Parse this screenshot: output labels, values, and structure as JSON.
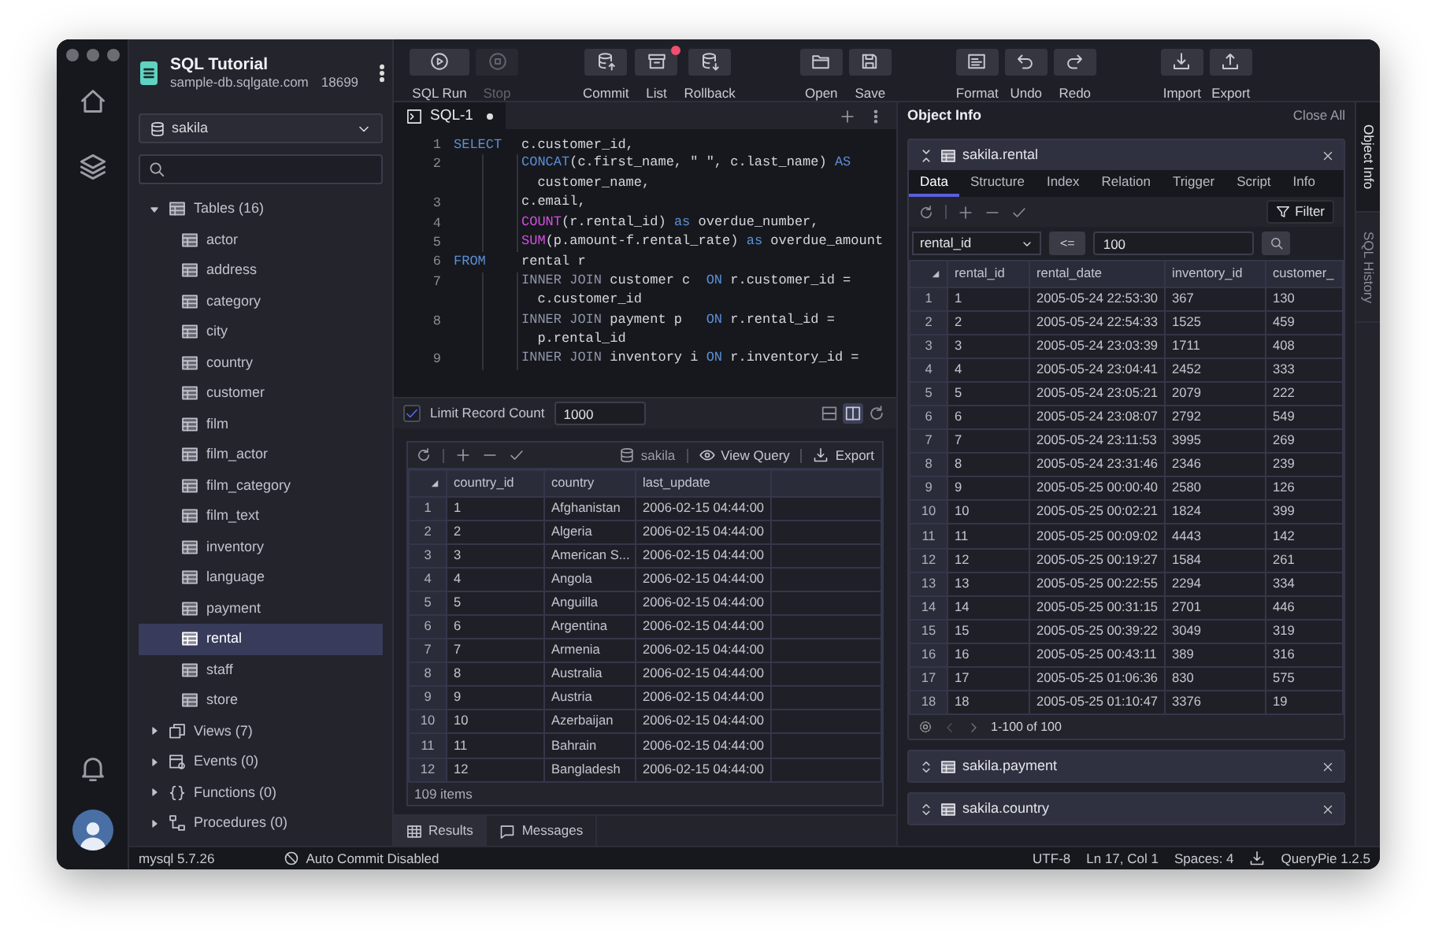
{
  "connection": {
    "title": "SQL Tutorial",
    "host": "sample-db.sqlgate.com",
    "port": "18699"
  },
  "database_select": {
    "value": "sakila"
  },
  "tree": [
    {
      "label": "Tables (16)",
      "kind": "tables",
      "expanded": true,
      "children": [
        {
          "label": "actor",
          "selected": false
        },
        {
          "label": "address",
          "selected": false
        },
        {
          "label": "category",
          "selected": false
        },
        {
          "label": "city",
          "selected": false
        },
        {
          "label": "country",
          "selected": false
        },
        {
          "label": "customer",
          "selected": false
        },
        {
          "label": "film",
          "selected": false
        },
        {
          "label": "film_actor",
          "selected": false
        },
        {
          "label": "film_category",
          "selected": false
        },
        {
          "label": "film_text",
          "selected": false
        },
        {
          "label": "inventory",
          "selected": false
        },
        {
          "label": "language",
          "selected": false
        },
        {
          "label": "payment",
          "selected": false
        },
        {
          "label": "rental",
          "selected": true
        },
        {
          "label": "staff",
          "selected": false
        },
        {
          "label": "store",
          "selected": false
        }
      ]
    },
    {
      "label": "Views (7)",
      "kind": "views",
      "expanded": false
    },
    {
      "label": "Events (0)",
      "kind": "events",
      "expanded": false
    },
    {
      "label": "Functions (0)",
      "kind": "functions",
      "expanded": false
    },
    {
      "label": "Procedures (0)",
      "kind": "procedures",
      "expanded": false
    }
  ],
  "toolbar": [
    [
      {
        "label": "SQL Run",
        "kind": "run",
        "disabled": false,
        "notification": false
      },
      {
        "label": "Stop",
        "kind": "stop",
        "disabled": true,
        "notification": false
      }
    ],
    [
      {
        "label": "Commit",
        "kind": "commit",
        "disabled": false,
        "notification": false
      },
      {
        "label": "List",
        "kind": "list",
        "disabled": false,
        "notification": true
      },
      {
        "label": "Rollback",
        "kind": "rollback",
        "disabled": false,
        "notification": false
      }
    ],
    [
      {
        "label": "Open",
        "kind": "open",
        "disabled": false,
        "notification": false
      },
      {
        "label": "Save",
        "kind": "save",
        "disabled": false,
        "notification": false
      }
    ],
    [
      {
        "label": "Format",
        "kind": "format",
        "disabled": false,
        "notification": false
      },
      {
        "label": "Undo",
        "kind": "undo",
        "disabled": false,
        "notification": false
      },
      {
        "label": "Redo",
        "kind": "redo",
        "disabled": false,
        "notification": false
      }
    ],
    [
      {
        "label": "Import",
        "kind": "import",
        "disabled": false,
        "notification": false
      },
      {
        "label": "Export",
        "kind": "export",
        "disabled": false,
        "notification": false
      }
    ]
  ],
  "editor": {
    "tabs": [
      {
        "label": "SQL-1",
        "selected": true,
        "modified": true
      }
    ],
    "lines": [
      {
        "number": "1",
        "keyword": "SELECT",
        "parts": [
          {
            "text": "c.customer_id,",
            "kind": "plain"
          }
        ]
      },
      {
        "number": "2",
        "parts": [
          {
            "text": "CONCAT",
            "kind": "keyword"
          },
          {
            "text": "(c.first_name, \" \", c.last_name) ",
            "kind": "plain"
          },
          {
            "text": "AS",
            "kind": "keyword"
          }
        ],
        "continuation": [
          {
            "text": "customer_name,",
            "kind": "plain"
          }
        ]
      },
      {
        "number": "3",
        "parts": [
          {
            "text": "c.email,",
            "kind": "plain"
          }
        ]
      },
      {
        "number": "4",
        "parts": [
          {
            "text": "COUNT",
            "kind": "function"
          },
          {
            "text": "(r.rental_id) ",
            "kind": "plain"
          },
          {
            "text": "as",
            "kind": "keyword"
          },
          {
            "text": " overdue_number,",
            "kind": "plain"
          }
        ]
      },
      {
        "number": "5",
        "parts": [
          {
            "text": "SUM",
            "kind": "function"
          },
          {
            "text": "(p.amount-f.rental_rate) ",
            "kind": "plain"
          },
          {
            "text": "as",
            "kind": "keyword"
          },
          {
            "text": " overdue_amount",
            "kind": "plain"
          }
        ]
      },
      {
        "number": "6",
        "keyword": "FROM",
        "parts": [
          {
            "text": "rental r",
            "kind": "plain"
          }
        ]
      },
      {
        "number": "7",
        "parts": [
          {
            "text": "INNER JOIN",
            "kind": "join"
          },
          {
            "text": " customer c  ",
            "kind": "plain"
          },
          {
            "text": "ON",
            "kind": "keyword"
          },
          {
            "text": " r.customer_id =",
            "kind": "plain"
          }
        ],
        "continuation": [
          {
            "text": "c.customer_id",
            "kind": "plain"
          }
        ]
      },
      {
        "number": "8",
        "parts": [
          {
            "text": "INNER JOIN",
            "kind": "join"
          },
          {
            "text": " payment p   ",
            "kind": "plain"
          },
          {
            "text": "ON",
            "kind": "keyword"
          },
          {
            "text": " r.rental_id =",
            "kind": "plain"
          }
        ],
        "continuation": [
          {
            "text": "p.rental_id",
            "kind": "plain"
          }
        ]
      },
      {
        "number": "9",
        "parts": [
          {
            "text": "INNER JOIN",
            "kind": "join"
          },
          {
            "text": " inventory i ",
            "kind": "plain"
          },
          {
            "text": "ON",
            "kind": "keyword"
          },
          {
            "text": " r.inventory_id =",
            "kind": "plain"
          }
        ]
      }
    ],
    "limit": {
      "checked": true,
      "label": "Limit Record Count",
      "value": "1000"
    },
    "layouts": [
      {
        "kind": "rows",
        "selected": false
      },
      {
        "kind": "columns",
        "selected": true
      }
    ]
  },
  "results": {
    "database": "sakila",
    "view_query": "View Query",
    "export": "Export",
    "columns": [
      "",
      "country_id",
      "country",
      "last_update"
    ],
    "rows": [
      [
        "1",
        "1",
        "Afghanistan",
        "2006-02-15 04:44:00"
      ],
      [
        "2",
        "2",
        "Algeria",
        "2006-02-15 04:44:00"
      ],
      [
        "3",
        "3",
        "American S...",
        "2006-02-15 04:44:00"
      ],
      [
        "4",
        "4",
        "Angola",
        "2006-02-15 04:44:00"
      ],
      [
        "5",
        "5",
        "Anguilla",
        "2006-02-15 04:44:00"
      ],
      [
        "6",
        "6",
        "Argentina",
        "2006-02-15 04:44:00"
      ],
      [
        "7",
        "7",
        "Armenia",
        "2006-02-15 04:44:00"
      ],
      [
        "8",
        "8",
        "Australia",
        "2006-02-15 04:44:00"
      ],
      [
        "9",
        "9",
        "Austria",
        "2006-02-15 04:44:00"
      ],
      [
        "10",
        "10",
        "Azerbaijan",
        "2006-02-15 04:44:00"
      ],
      [
        "11",
        "11",
        "Bahrain",
        "2006-02-15 04:44:00"
      ],
      [
        "12",
        "12",
        "Bangladesh",
        "2006-02-15 04:44:00"
      ]
    ],
    "footer": "109 items"
  },
  "result_tabs": [
    {
      "label": "Results",
      "kind": "grid",
      "selected": true
    },
    {
      "label": "Messages",
      "kind": "messages",
      "selected": false
    }
  ],
  "object_info": {
    "title": "Object Info",
    "close_all": "Close All",
    "panels": [
      {
        "title": "sakila.rental",
        "expanded": true,
        "tabs": [
          {
            "label": "Data",
            "selected": true
          },
          {
            "label": "Structure",
            "selected": false
          },
          {
            "label": "Index",
            "selected": false
          },
          {
            "label": "Relation",
            "selected": false
          },
          {
            "label": "Trigger",
            "selected": false
          },
          {
            "label": "Script",
            "selected": false
          },
          {
            "label": "Info",
            "selected": false
          }
        ],
        "filter_button": "Filter",
        "filter": {
          "column": "rental_id",
          "operator": "<=",
          "value": "100"
        },
        "columns": [
          "",
          "rental_id",
          "rental_date",
          "inventory_id",
          "customer_"
        ],
        "rows": [
          [
            "1",
            "1",
            "2005-05-24 22:53:30",
            "367",
            "130"
          ],
          [
            "2",
            "2",
            "2005-05-24 22:54:33",
            "1525",
            "459"
          ],
          [
            "3",
            "3",
            "2005-05-24 23:03:39",
            "1711",
            "408"
          ],
          [
            "4",
            "4",
            "2005-05-24 23:04:41",
            "2452",
            "333"
          ],
          [
            "5",
            "5",
            "2005-05-24 23:05:21",
            "2079",
            "222"
          ],
          [
            "6",
            "6",
            "2005-05-24 23:08:07",
            "2792",
            "549"
          ],
          [
            "7",
            "7",
            "2005-05-24 23:11:53",
            "3995",
            "269"
          ],
          [
            "8",
            "8",
            "2005-05-24 23:31:46",
            "2346",
            "239"
          ],
          [
            "9",
            "9",
            "2005-05-25 00:00:40",
            "2580",
            "126"
          ],
          [
            "10",
            "10",
            "2005-05-25 00:02:21",
            "1824",
            "399"
          ],
          [
            "11",
            "11",
            "2005-05-25 00:09:02",
            "4443",
            "142"
          ],
          [
            "12",
            "12",
            "2005-05-25 00:19:27",
            "1584",
            "261"
          ],
          [
            "13",
            "13",
            "2005-05-25 00:22:55",
            "2294",
            "334"
          ],
          [
            "14",
            "14",
            "2005-05-25 00:31:15",
            "2701",
            "446"
          ],
          [
            "15",
            "15",
            "2005-05-25 00:39:22",
            "3049",
            "319"
          ],
          [
            "16",
            "16",
            "2005-05-25 00:43:11",
            "389",
            "316"
          ],
          [
            "17",
            "17",
            "2005-05-25 01:06:36",
            "830",
            "575"
          ],
          [
            "18",
            "18",
            "2005-05-25 01:10:47",
            "3376",
            "19"
          ]
        ],
        "pager": "1-100 of 100"
      },
      {
        "title": "sakila.payment",
        "expanded": false
      },
      {
        "title": "sakila.country",
        "expanded": false
      }
    ]
  },
  "side_tabs": [
    {
      "label": "Object Info",
      "selected": true
    },
    {
      "label": "SQL History",
      "selected": false
    }
  ],
  "status_bar": {
    "server": "mysql 5.7.26",
    "auto_commit": "Auto Commit Disabled",
    "encoding": "UTF-8",
    "cursor": "Ln 17, Col 1",
    "indent": "Spaces: 4",
    "app": "QueryPie 1.2.5"
  }
}
